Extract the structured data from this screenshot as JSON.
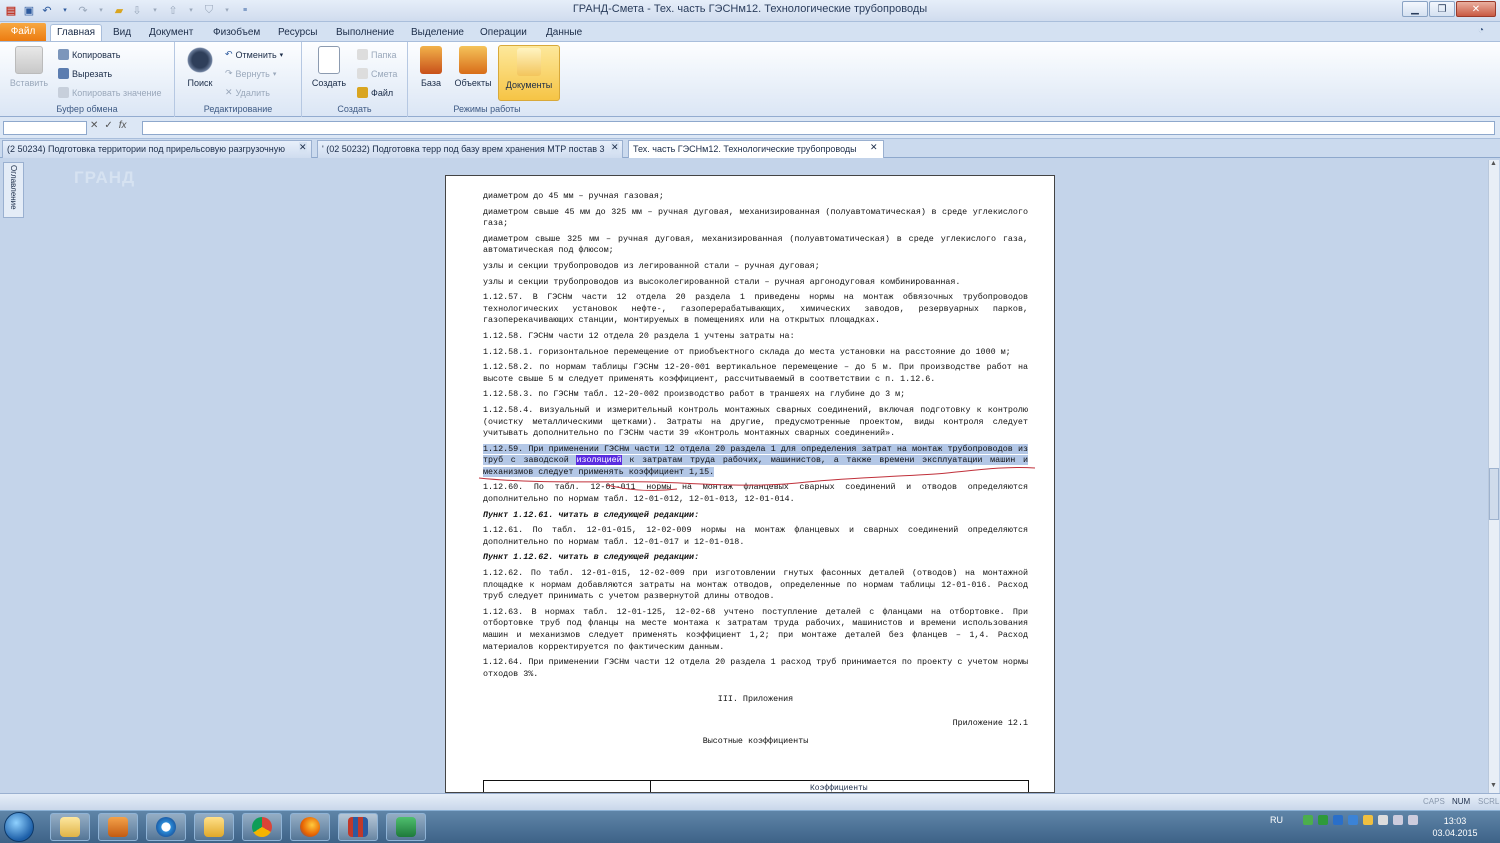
{
  "window": {
    "title": "ГРАНД-Смета - Тех. часть ГЭСНм12. Технологические трубопроводы"
  },
  "ribbon": {
    "tabs": [
      "Файл",
      "Главная",
      "Вид",
      "Документ",
      "Физобъем",
      "Ресурсы",
      "Выполнение",
      "Выделение",
      "Операции",
      "Данные"
    ],
    "groups": {
      "clipboard": {
        "label": "Буфер обмена",
        "paste": "Вставить",
        "copy": "Копировать",
        "cut": "Вырезать",
        "copy_value": "Копировать значение"
      },
      "editing": {
        "label": "Редактирование",
        "search": "Поиск",
        "undo": "Отменить",
        "redo": "Вернуть",
        "delete": "Удалить"
      },
      "create": {
        "label": "Создать",
        "create": "Создать",
        "folder": "Папка",
        "estimate": "Смета",
        "file": "Файл"
      },
      "modes": {
        "label": "Режимы работы",
        "base": "База",
        "objects": "Объекты",
        "documents": "Документы"
      }
    }
  },
  "doc_tabs": [
    {
      "label": "(2 50234) Подготовка территории под прирельсовую разгрузочную",
      "active": false
    },
    {
      "label": "' (02 50232) Подготовка терр под базу врем хранения МТР постав 3",
      "active": false
    },
    {
      "label": "Тех. часть ГЭСНм12. Технологические трубопроводы",
      "active": true
    }
  ],
  "side_panel": {
    "label": "Оглавление"
  },
  "logo": {
    "text": "ГРАНД"
  },
  "document": {
    "paragraphs": [
      {
        "text": "диаметром до 45 мм – ручная газовая;"
      },
      {
        "text": "диаметром свыше 45 мм до 325 мм – ручная дуговая, механизированная (полуавтоматическая) в среде углекислого газа;"
      },
      {
        "text": "диаметром свыше 325 мм – ручная дуговая, механизированная (полуавтоматическая) в среде углекислого газа, автоматическая под флюсом;"
      },
      {
        "text": "узлы и секции трубопроводов из легированной стали – ручная дуговая;"
      },
      {
        "text": "узлы и секции трубопроводов из высоколегированной стали – ручная аргонодуговая комбинированная."
      },
      {
        "text": "1.12.57. В ГЭСНм части 12 отдела 20 раздела 1 приведены нормы на монтаж обвязочных трубопроводов технологических установок нефте-, газоперерабатывающих, химических заводов, резервуарных парков, газоперекачивающих станции, монтируемых в помещениях или на открытых площадках."
      },
      {
        "text": "1.12.58. ГЭСНм части 12 отдела 20 раздела 1 учтены затраты на:"
      },
      {
        "text": "1.12.58.1. горизонтальное перемещение от приобъектного склада до места установки на расстояние до 1000 м;"
      },
      {
        "text": "1.12.58.2. по нормам таблицы ГЭСНм 12-20-001 вертикальное перемещение – до 5 м. При производстве работ на высоте свыше 5 м следует применять коэффициент, рассчитываемый в соответствии с п. 1.12.6."
      },
      {
        "text": "1.12.58.3. по ГЭСНм табл. 12-20-002 производство работ в траншеях на глубине до 3 м;"
      },
      {
        "text": "1.12.58.4. визуальный и измерительный контроль монтажных сварных соединений, включая подготовку к контролю (очистку металлическими щетками). Затраты на другие, предусмотренные проектом, виды контроля следует учитывать дополнительно по ГЭСНм части 39 «Контроль монтажных сварных соединений»."
      }
    ],
    "selected": {
      "before": "1.12.59. При применении ГЭСНм части 12 отдела 20 раздела 1 для определения затрат на монтаж трубопроводов из труб с заводской ",
      "highlight": "изоляцией",
      "after": " к затратам труда рабочих, машинистов, а также времени эксплуатации машин и механизмов следует применять коэффициент 1,15."
    },
    "paragraphs2": [
      {
        "text": "1.12.60. По табл. 12-01-011 нормы на монтаж фланцевых сварных соединений и отводов определяются дополнительно по нормам табл. 12-01-012, 12-01-013, 12-01-014."
      },
      {
        "text": "Пункт 1.12.61. читать в следующей редакции:",
        "italic": true
      },
      {
        "text": "1.12.61. По табл. 12-01-015, 12-02-009 нормы на монтаж фланцевых и сварных соединений определяются дополнительно по нормам табл. 12-01-017 и 12-01-018."
      },
      {
        "text": "Пункт 1.12.62. читать в следующей редакции:",
        "italic": true
      },
      {
        "text": "1.12.62. По табл. 12-01-015, 12-02-009 при изготовлении гнутых фасонных деталей (отводов) на монтажной площадке к нормам добавляются затраты на монтаж отводов, определенные по нормам таблицы 12-01-016. Расход труб следует принимать с учетом развернутой длины отводов."
      },
      {
        "text": "1.12.63. В нормах табл. 12-01-125, 12-02-68 учтено поступление деталей с фланцами на отбортовке. При отбортовке труб под фланцы на месте монтажа к затратам труда рабочих, машинистов и времени использования машин и механизмов следует применять коэффициент 1,2; при монтаже деталей без фланцев – 1,4. Расход материалов корректируется по фактическим данным."
      },
      {
        "text": "1.12.64. При применении ГЭСНм части 12 отдела 20 раздела 1 расход труб принимается по проекту с учетом нормы отходов 3%."
      }
    ],
    "section_title": "III. Приложения",
    "appendix_label": "Приложение 12.1",
    "appendix_title": "Высотные коэффициенты",
    "table_header": "Коэффициенты"
  },
  "statusbar": {
    "caps": "CAPS",
    "num": "NUM",
    "scrl": "SCRL"
  },
  "taskbar": {
    "lang": "RU",
    "time": "13:03",
    "date": "03.04.2015"
  },
  "colors": {
    "accent_file_tab": "#ec7b10",
    "selection": "#b3c7e6",
    "highlight": "#5a2de0",
    "annotation_line": "#c0303a"
  }
}
